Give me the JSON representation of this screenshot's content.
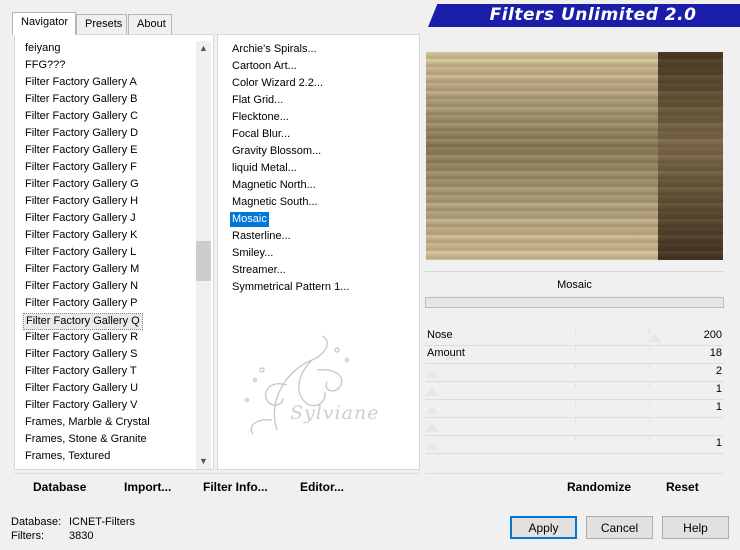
{
  "header": {
    "tabs": [
      {
        "label": "Navigator",
        "active": true
      },
      {
        "label": "Presets",
        "active": false
      },
      {
        "label": "About",
        "active": false
      }
    ],
    "banner_title": "Filters Unlimited 2.0"
  },
  "categories": {
    "items": [
      "feiyang",
      "FFG???",
      "Filter Factory Gallery A",
      "Filter Factory Gallery B",
      "Filter Factory Gallery C",
      "Filter Factory Gallery D",
      "Filter Factory Gallery E",
      "Filter Factory Gallery F",
      "Filter Factory Gallery G",
      "Filter Factory Gallery H",
      "Filter Factory Gallery J",
      "Filter Factory Gallery K",
      "Filter Factory Gallery L",
      "Filter Factory Gallery M",
      "Filter Factory Gallery N",
      "Filter Factory Gallery P",
      "Filter Factory Gallery Q",
      "Filter Factory Gallery R",
      "Filter Factory Gallery S",
      "Filter Factory Gallery T",
      "Filter Factory Gallery U",
      "Filter Factory Gallery V",
      "Frames, Marble & Crystal",
      "Frames, Stone & Granite",
      "Frames, Textured"
    ],
    "selected": "Filter Factory Gallery Q"
  },
  "filters": {
    "items": [
      "Archie's Spirals...",
      "Cartoon Art...",
      "Color Wizard 2.2...",
      "Flat Grid...",
      "Flecktone...",
      "Focal Blur...",
      "Gravity Blossom...",
      "liquid Metal...",
      "Magnetic North...",
      "Magnetic South...",
      "Mosaic",
      "Rasterline...",
      "Smiley...",
      "Streamer...",
      "Symmetrical Pattern 1..."
    ],
    "selected": "Mosaic"
  },
  "watermark": {
    "text": "Sylviane"
  },
  "preview": {
    "filter_name": "Mosaic"
  },
  "parameters": [
    {
      "label": "Nose",
      "value": "200",
      "level": 0.784
    },
    {
      "label": "Amount",
      "value": "18",
      "level": 0.07
    },
    {
      "label": "",
      "value": "2",
      "level": 0.0
    },
    {
      "label": "",
      "value": "1",
      "level": 0.0
    },
    {
      "label": "",
      "value": "1",
      "level": 0.0
    },
    {
      "label": "",
      "value": "",
      "level": 0.0
    },
    {
      "label": "",
      "value": "1",
      "level": 0.0
    }
  ],
  "buttons": {
    "database": "Database",
    "import": "Import...",
    "filter_info": "Filter Info...",
    "editor": "Editor...",
    "randomize": "Randomize",
    "reset": "Reset",
    "apply": "Apply",
    "cancel": "Cancel",
    "help": "Help"
  },
  "status": {
    "database_label": "Database:",
    "database_value": "ICNET-Filters",
    "filters_label": "Filters:",
    "filters_value": "3830"
  }
}
